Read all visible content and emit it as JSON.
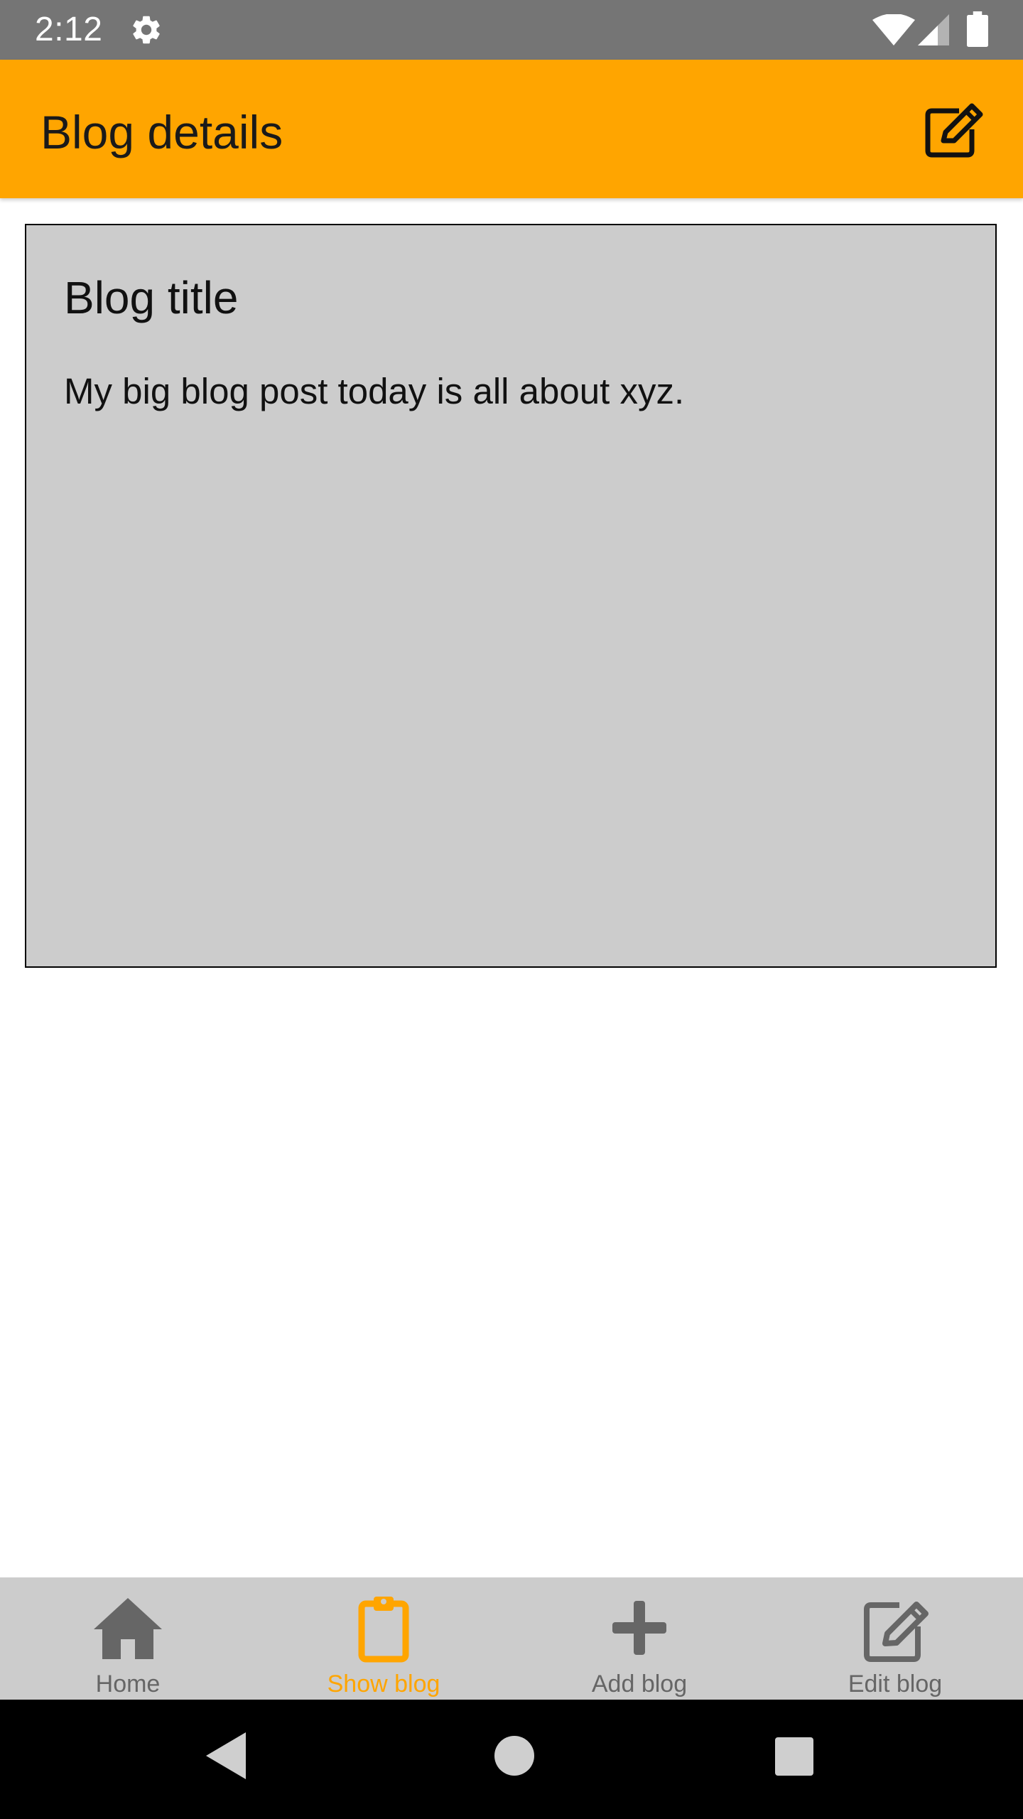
{
  "status_bar": {
    "time": "2:12",
    "icons": [
      "gear-icon",
      "wifi-icon",
      "cellular-signal-icon",
      "battery-icon"
    ]
  },
  "app_bar": {
    "title": "Blog details",
    "action_icon": "edit-icon",
    "background_color": "#ffa500"
  },
  "blog": {
    "title": "Blog title",
    "body": "My big blog post today is all about xyz."
  },
  "bottom_nav": {
    "active_color": "#ffa500",
    "inactive_color": "#666666",
    "items": [
      {
        "label": "Home",
        "icon": "home-icon",
        "active": false
      },
      {
        "label": "Show blog",
        "icon": "clipboard-icon",
        "active": true
      },
      {
        "label": "Add blog",
        "icon": "plus-icon",
        "active": false
      },
      {
        "label": "Edit blog",
        "icon": "edit-icon",
        "active": false
      }
    ]
  },
  "system_nav": {
    "icons": [
      "back-icon",
      "home-circle-icon",
      "recents-icon"
    ]
  }
}
